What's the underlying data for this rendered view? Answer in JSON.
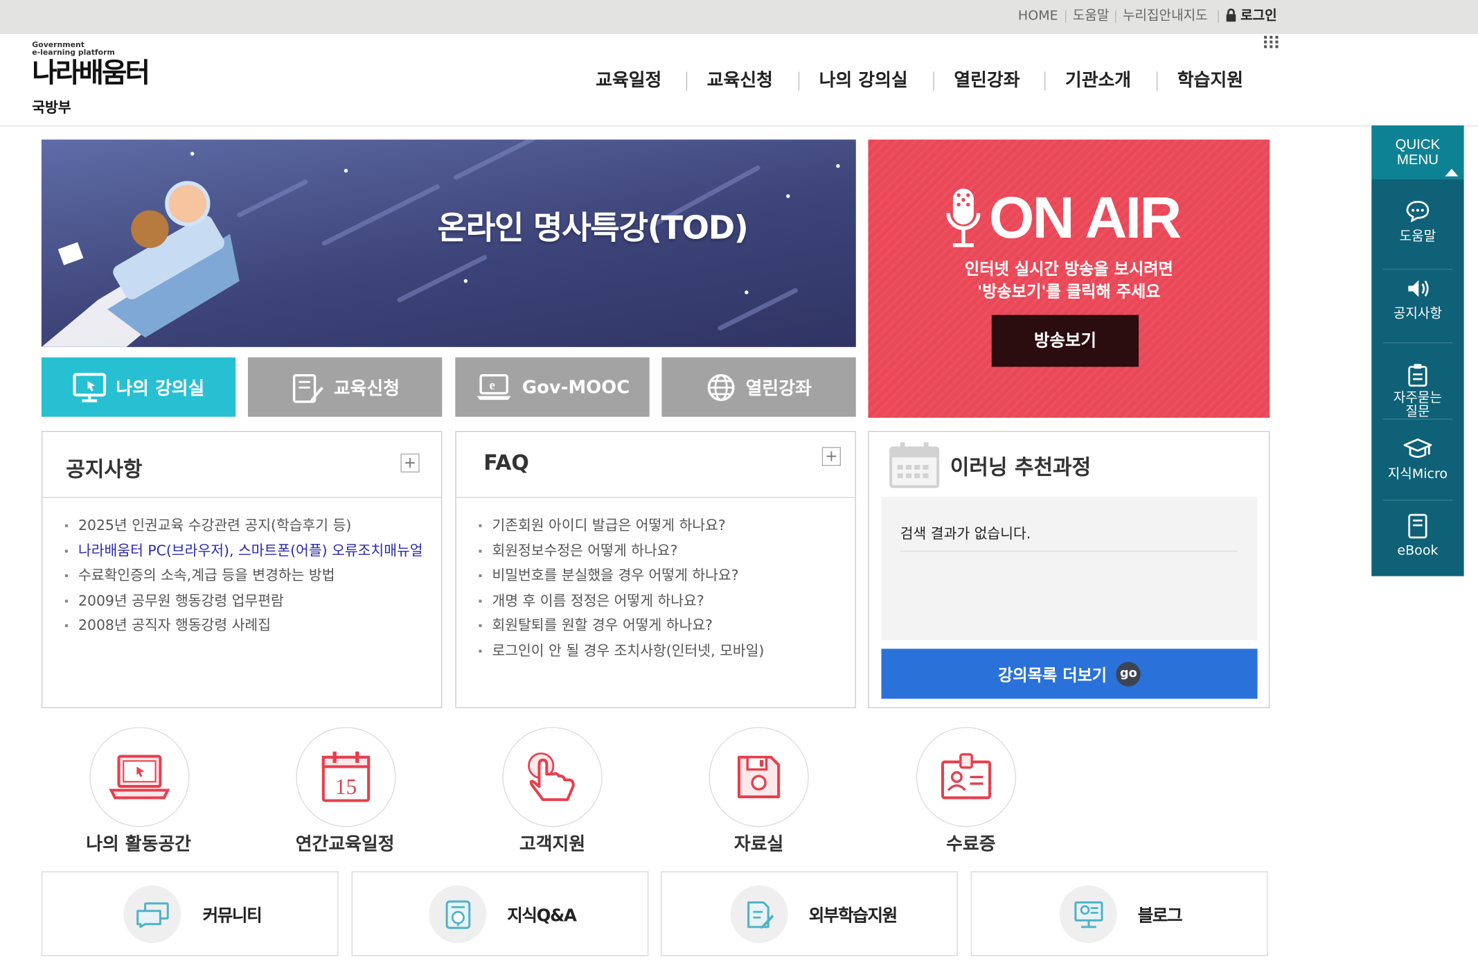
{
  "util_nav": {
    "home": "HOME",
    "help": "도움말",
    "sitemap": "누리집안내지도",
    "login": "로그인"
  },
  "logo": {
    "tagline_1": "Government",
    "tagline_2": "e-learning platform",
    "name": "나라배움터",
    "org": "국방부"
  },
  "gnb": [
    "교육일정",
    "교육신청",
    "나의 강의실",
    "열린강좌",
    "기관소개",
    "학습지원"
  ],
  "main_banner": {
    "title": "온라인 명사특강(TOD)"
  },
  "on_air": {
    "title": "ON AIR",
    "line1": "인터넷 실시간 방송을 보시려면",
    "line2": "'방송보기'를 클릭해 주세요",
    "button": "방송보기",
    "bg_color": "#ea4757"
  },
  "quick_buttons": [
    {
      "label": "나의 강의실",
      "icon": "monitor-icon",
      "color": "#27c0d2"
    },
    {
      "label": "교육신청",
      "icon": "edit-document-icon",
      "color": "#a3a3a3"
    },
    {
      "label": "Gov-MOOC",
      "icon": "laptop-ie-icon",
      "color": "#a3a3a3"
    },
    {
      "label": "열린강좌",
      "icon": "globe-icon",
      "color": "#a3a3a3"
    }
  ],
  "notice": {
    "title": "공지사항",
    "more": "+",
    "items": [
      "2025년 인권교육 수강관련 공지(학습후기 등)",
      "나라배움터 PC(브라우저), 스마트폰(어플) 오류조치매뉴얼",
      "수료확인증의 소속,계급 등을 변경하는 방법",
      "2009년 공무원 행동강령 업무편람",
      "2008년 공직자 행동강령 사례집"
    ]
  },
  "faq": {
    "title": "FAQ",
    "more": "+",
    "items": [
      "기존회원 아이디 발급은 어떻게 하나요?",
      "회원정보수정은 어떻게 하나요?",
      "비밀번호를 분실했을 경우 어떻게 하나요?",
      "개명 후 이름 정정은 어떻게 하나요?",
      "회원탈퇴를 원할 경우 어떻게 하나요?",
      "로그인이 안 될 경우 조치사항(인터넷, 모바일)"
    ]
  },
  "recommend": {
    "title": "이러닝 추천과정",
    "empty": "검색 결과가 없습니다.",
    "more_button": "강의목록 더보기",
    "go": "go",
    "button_color": "#2a71d9"
  },
  "round_links": [
    {
      "label": "나의 활동공간",
      "icon": "laptop-icon"
    },
    {
      "label": "연간교육일정",
      "icon": "calendar-icon",
      "day": "15"
    },
    {
      "label": "고객지원",
      "icon": "touch-hand-icon"
    },
    {
      "label": "자료실",
      "icon": "floppy-disk-icon"
    },
    {
      "label": "수료증",
      "icon": "id-card-icon"
    }
  ],
  "bottom_links": [
    {
      "label": "커뮤니티",
      "icon": "chat-icon"
    },
    {
      "label": "지식Q&A",
      "icon": "qa-icon"
    },
    {
      "label": "외부학습지원",
      "icon": "document-pen-icon"
    },
    {
      "label": "블로그",
      "icon": "blog-icon"
    }
  ],
  "quick_menu": {
    "title_1": "QUICK",
    "title_2": "MENU",
    "items": [
      {
        "label": "도움말",
        "icon": "speech-bubble-icon"
      },
      {
        "label": "공지사항",
        "icon": "speaker-icon"
      },
      {
        "label": "자주묻는\n질문",
        "icon": "clipboard-icon"
      },
      {
        "label": "지식Micro",
        "icon": "graduation-cap-icon"
      },
      {
        "label": "eBook",
        "icon": "ebook-icon"
      }
    ]
  }
}
